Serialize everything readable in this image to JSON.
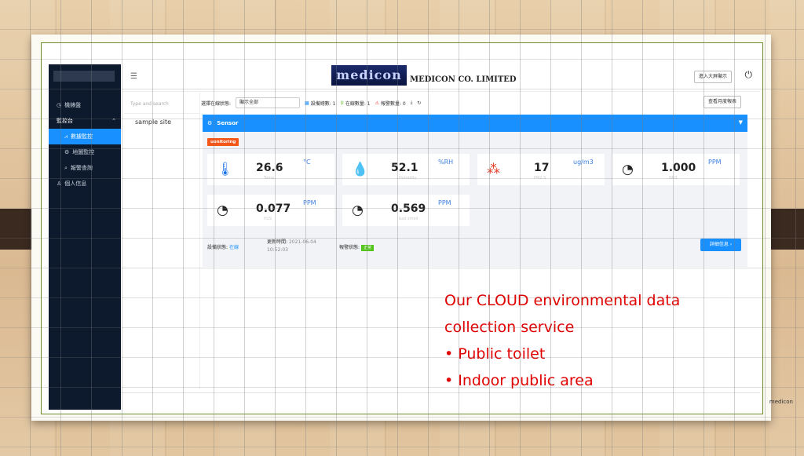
{
  "sidebar": {
    "items": [
      {
        "icon": "clock-icon",
        "label": "機錶盤"
      },
      {
        "label": "監控台"
      },
      {
        "icon": "chart-icon",
        "label": "數據監控"
      },
      {
        "icon": "gear-icon",
        "label": "地圖監控"
      },
      {
        "icon": "search-icon",
        "label": "報警查詢"
      },
      {
        "icon": "user-icon",
        "label": "個人信息"
      }
    ]
  },
  "header": {
    "logo_text": "medicon",
    "company": "MEDICON CO. LIMITED",
    "fullscreen_label": "進入大屏顯示"
  },
  "leftpane": {
    "search_placeholder": "Type and search",
    "site": "sample site"
  },
  "filters": {
    "online_status_label": "選擇在線狀態:",
    "online_status_value": "顯示全部",
    "device_total": "設備總數: 1",
    "online_count": "在線數量: 1",
    "alarm_count": "報警數量: 0",
    "monthly_report": "查看月度報表"
  },
  "sensor": {
    "title": "Sensor",
    "tag": "uonitoring",
    "cards": [
      {
        "icon": "thermometer-icon",
        "value": "26.6",
        "unit": "°C",
        "name": "Temp"
      },
      {
        "icon": "droplet-icon",
        "value": "52.1",
        "unit": "%RH",
        "name": "Humidity"
      },
      {
        "icon": "particles-icon",
        "value": "17",
        "unit": "ug/m3",
        "name": "PM2.5"
      },
      {
        "icon": "gauge-icon",
        "value": "1.000",
        "unit": "PPM",
        "name": "NH3"
      },
      {
        "icon": "gauge-icon",
        "value": "0.077",
        "unit": "PPM",
        "name": "H2S"
      },
      {
        "icon": "gauge-icon",
        "value": "0.569",
        "unit": "PPM",
        "name": "bad smell"
      }
    ],
    "device_status_label": "設備狀態:",
    "device_status_value": "在線",
    "update_time_label": "更新時間:",
    "update_date": "2021-06-04",
    "update_time": "10:52:03",
    "alarm_status_label": "報警狀態:",
    "alarm_status_value": "正常",
    "detail_label": "詳細信息"
  },
  "footer": {
    "brand": "medicon"
  },
  "overlay": {
    "line1": "Our CLOUD environmental data",
    "line2": "collection service",
    "line3": "• Public toilet",
    "line4": "• Indoor public area"
  },
  "colors": {
    "accent": "#1890ff",
    "alert": "#e10000",
    "sidebar": "#0d1a2d"
  }
}
